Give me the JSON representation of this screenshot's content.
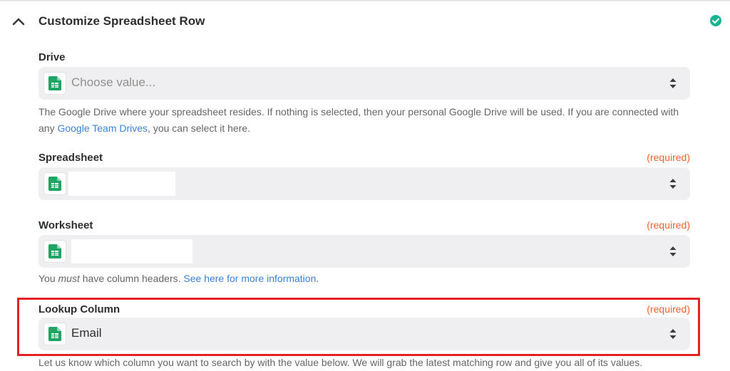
{
  "section": {
    "title": "Customize Spreadsheet Row",
    "collapse_icon": "chevron-up-icon",
    "status_icon": "check-circle-icon",
    "status_color": "#1ab394"
  },
  "fields": {
    "drive": {
      "label": "Drive",
      "placeholder": "Choose value...",
      "help_pre": "The Google Drive where your spreadsheet resides. If nothing is selected, then your personal Google Drive will be used. If you are connected with any ",
      "help_link": "Google Team Drives",
      "help_post": ", you can select it here."
    },
    "spreadsheet": {
      "label": "Spreadsheet",
      "required": "(required)"
    },
    "worksheet": {
      "label": "Worksheet",
      "required": "(required)",
      "help_pre": "You ",
      "help_em": "must",
      "help_mid": " have column headers. ",
      "help_link": "See here for more information",
      "help_post": "."
    },
    "lookup_column": {
      "label": "Lookup Column",
      "required": "(required)",
      "value": "Email",
      "help": "Let us know which column you want to search by with the value below. We will grab the latest matching row and give you all of its values."
    }
  },
  "icons": {
    "app": "google-sheets-icon",
    "select_arrows": "up-down-arrows-icon"
  },
  "colors": {
    "required": "#f3612c",
    "link": "#3b82d6",
    "highlight": "#e32024",
    "sheets_green": "#1fa463"
  }
}
